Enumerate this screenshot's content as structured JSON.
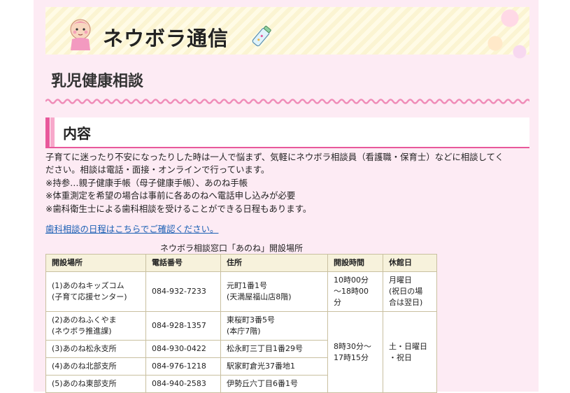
{
  "banner": {
    "title": "ネウボラ通信"
  },
  "page_title": "乳児健康相談",
  "section": {
    "title": "内容"
  },
  "body_lines": [
    "子育てに迷ったり不安になったりした時は一人で悩まず、気軽にネウボラ相談員（看護職・保育士）などに相談してく",
    "ださい。相談は電話・面接・オンラインで行っています。",
    "※持参…親子健康手帳（母子健康手帳）、あのね手帳",
    "※体重測定を希望の場合は事前に各あのねへ電話申し込みが必要",
    "※歯科衛生士による歯科相談を受けることができる日程もあります。"
  ],
  "link_text": "歯科相談の日程はこちらでご確認ください。",
  "table": {
    "caption": "ネウボラ相談窓口「あのね」開設場所",
    "headers": [
      "開設場所",
      "電話番号",
      "住所",
      "開設時間",
      "休館日"
    ],
    "rows": [
      {
        "place": "(1)あのねキッズコム\n(子育て応援センター)",
        "phone": "084-932-7233",
        "address": "元町1番1号\n(天満屋福山店8階)",
        "hours": "10時00分\n～18時00\n分",
        "closed": "月曜日\n(祝日の場\n合は翌日)"
      },
      {
        "place": "(2)あのねふくやま\n(ネウボラ推進課)",
        "phone": "084-928-1357",
        "address": "東桜町3番5号\n(本庁7階)"
      },
      {
        "place": "(3)あのね松永支所",
        "phone": "084-930-0422",
        "address": "松永町三丁目1番29号"
      },
      {
        "place": "(4)あのね北部支所",
        "phone": "084-976-1218",
        "address": "駅家町倉光37番地1"
      },
      {
        "place": "(5)あのね東部支所",
        "phone": "084-940-2583",
        "address": "伊勢丘六丁目6番1号"
      }
    ],
    "shared_hours": "8時30分～\n17時15分",
    "shared_closed": "土・日曜日\n・祝日"
  }
}
